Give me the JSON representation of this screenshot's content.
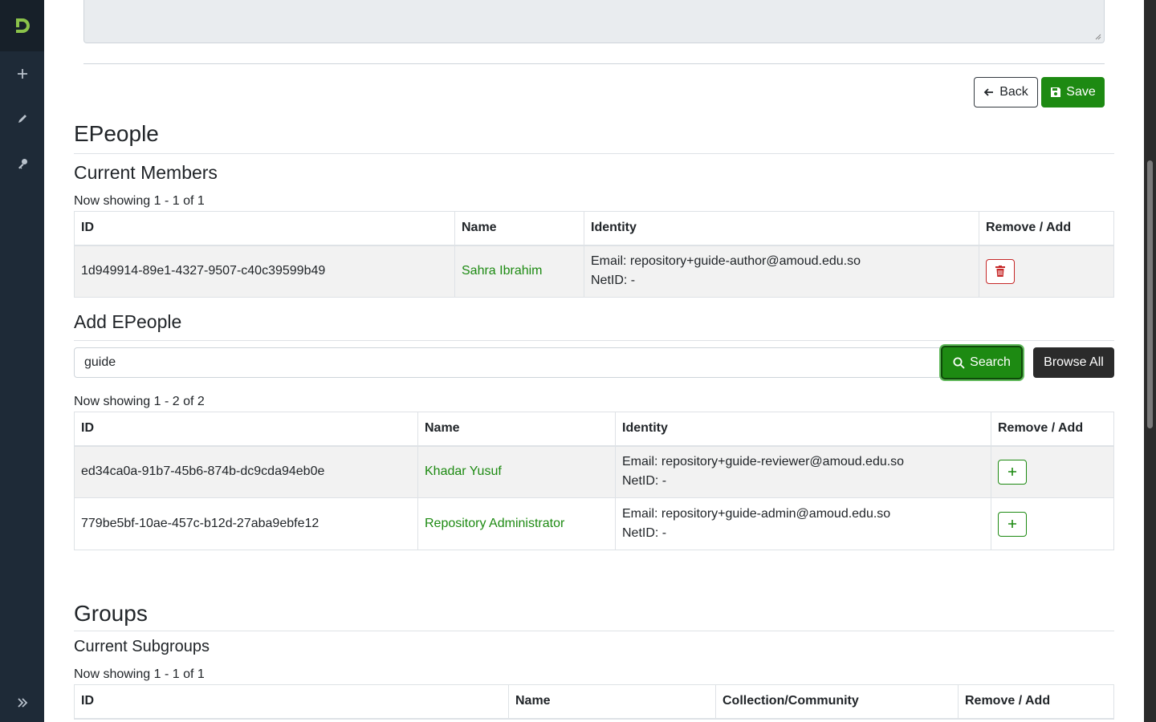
{
  "sidebar": {
    "logo_icon": "dspace-logo-icon",
    "items": [
      {
        "icon": "plus-icon"
      },
      {
        "icon": "pencil-icon"
      },
      {
        "icon": "key-icon"
      }
    ],
    "collapse_icon": "double-chevron-right-icon"
  },
  "form": {
    "back_label": "Back",
    "save_label": "Save"
  },
  "epeople": {
    "title": "EPeople",
    "current_members": {
      "title": "Current Members",
      "showing": "Now showing 1 - 1 of 1",
      "columns": [
        "ID",
        "Name",
        "Identity",
        "Remove / Add"
      ],
      "rows": [
        {
          "id": "1d949914-89e1-4327-9507-c40c39599b49",
          "name": "Sahra Ibrahim",
          "email": "Email: repository+guide-author@amoud.edu.so",
          "netid": "NetID: -"
        }
      ]
    },
    "add": {
      "title": "Add EPeople",
      "search_value": "guide",
      "search_label": "Search",
      "browse_label": "Browse All",
      "showing": "Now showing 1 - 2 of 2",
      "columns": [
        "ID",
        "Name",
        "Identity",
        "Remove / Add"
      ],
      "rows": [
        {
          "id": "ed34ca0a-91b7-45b6-874b-dc9cda94eb0e",
          "name": "Khadar Yusuf",
          "email": "Email: repository+guide-reviewer@amoud.edu.so",
          "netid": "NetID: -"
        },
        {
          "id": "779be5bf-10ae-457c-b12d-27aba9ebfe12",
          "name": "Repository Administrator",
          "email": "Email: repository+guide-admin@amoud.edu.so",
          "netid": "NetID: -"
        }
      ]
    }
  },
  "groups": {
    "title": "Groups",
    "current_subgroups": {
      "title": "Current Subgroups",
      "showing": "Now showing 1 - 1 of 1",
      "columns": [
        "ID",
        "Name",
        "Collection/Community",
        "Remove / Add"
      ]
    }
  },
  "colors": {
    "accent": "#1d8a12",
    "sidebar": "#1e2a37",
    "danger": "#c62828"
  }
}
